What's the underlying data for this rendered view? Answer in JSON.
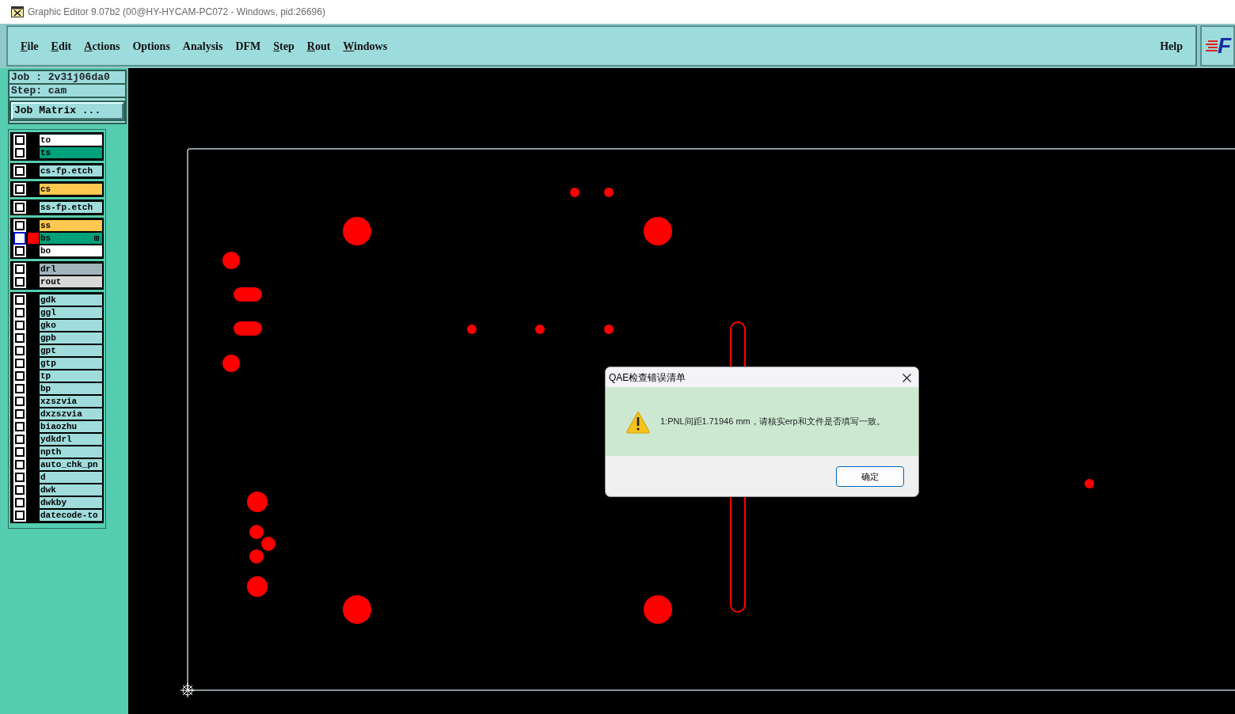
{
  "window": {
    "title": "Graphic Editor 9.07b2 (00@HY-HYCAM-PC072 - Windows, pid:26696)"
  },
  "menu": [
    {
      "label": "File",
      "mnemonic": true
    },
    {
      "label": "Edit",
      "mnemonic": true
    },
    {
      "label": "Actions",
      "mnemonic": true
    },
    {
      "label": "Options",
      "mnemonic": false
    },
    {
      "label": "Analysis",
      "mnemonic": false
    },
    {
      "label": "DFM",
      "mnemonic": false
    },
    {
      "label": "Step",
      "mnemonic": true
    },
    {
      "label": "Rout",
      "mnemonic": true
    },
    {
      "label": "Windows",
      "mnemonic": true
    }
  ],
  "help": "Help",
  "logo_text": "F",
  "job": "Job : 2v31j06da0",
  "step": "Step: cam",
  "job_matrix_button": "Job Matrix ...",
  "layer_groups": [
    {
      "layers": [
        {
          "name": "to",
          "color": "#ffffff",
          "checked": false,
          "selected": false
        },
        {
          "name": "ts",
          "color": "#00a07a",
          "checked": false,
          "selected": false
        }
      ]
    },
    {
      "layers": [
        {
          "name": "cs-fp.etch",
          "color": "#a0dcdc",
          "checked": false,
          "selected": false
        }
      ]
    },
    {
      "layers": [
        {
          "name": "cs",
          "color": "#ffc850",
          "checked": false,
          "selected": false
        }
      ]
    },
    {
      "layers": [
        {
          "name": "ss-fp.etch",
          "color": "#a0dcdc",
          "checked": false,
          "selected": false
        }
      ]
    },
    {
      "layers": [
        {
          "name": "ss",
          "color": "#ffc850",
          "checked": false,
          "selected": false
        },
        {
          "name": "bs",
          "color": "#00a07a",
          "checked": false,
          "selected": true
        },
        {
          "name": "bo",
          "color": "#ffffff",
          "checked": false,
          "selected": false
        }
      ]
    },
    {
      "layers": [
        {
          "name": "drl",
          "color": "#a0b4bc",
          "checked": false,
          "selected": false
        },
        {
          "name": "rout",
          "color": "#d8d8d8",
          "checked": false,
          "selected": false
        }
      ]
    },
    {
      "layers": [
        {
          "name": "gdk",
          "color": "#a0dcdc",
          "checked": false,
          "selected": false
        },
        {
          "name": "ggl",
          "color": "#a0dcdc",
          "checked": false,
          "selected": false
        },
        {
          "name": "gko",
          "color": "#a0dcdc",
          "checked": false,
          "selected": false
        },
        {
          "name": "gpb",
          "color": "#a0dcdc",
          "checked": false,
          "selected": false
        },
        {
          "name": "gpt",
          "color": "#a0dcdc",
          "checked": false,
          "selected": false
        },
        {
          "name": "gtp",
          "color": "#a0dcdc",
          "checked": false,
          "selected": false
        },
        {
          "name": "tp",
          "color": "#a0dcdc",
          "checked": false,
          "selected": false
        },
        {
          "name": "bp",
          "color": "#a0dcdc",
          "checked": false,
          "selected": false
        },
        {
          "name": "xzszvia",
          "color": "#a0dcdc",
          "checked": false,
          "selected": false
        },
        {
          "name": "dxzszvia",
          "color": "#a0dcdc",
          "checked": false,
          "selected": false
        },
        {
          "name": "biaozhu",
          "color": "#a0dcdc",
          "checked": false,
          "selected": false
        },
        {
          "name": "ydkdrl",
          "color": "#a0dcdc",
          "checked": false,
          "selected": false
        },
        {
          "name": "npth",
          "color": "#a0dcdc",
          "checked": false,
          "selected": false
        },
        {
          "name": "auto_chk_pn",
          "color": "#a0dcdc",
          "checked": false,
          "selected": false
        },
        {
          "name": "d",
          "color": "#a0dcdc",
          "checked": false,
          "selected": false
        },
        {
          "name": "dwk",
          "color": "#a0dcdc",
          "checked": false,
          "selected": false
        },
        {
          "name": "dwkby",
          "color": "#a0dcdc",
          "checked": false,
          "selected": false
        },
        {
          "name": "datecode-to",
          "color": "#a0dcdc",
          "checked": false,
          "selected": false
        }
      ]
    }
  ],
  "dialog": {
    "title": "QAE检查错误清单",
    "message": "1:PNL间距1.71946 mm，请核实erp和文件是否填写一致。",
    "ok_button": "确定"
  }
}
